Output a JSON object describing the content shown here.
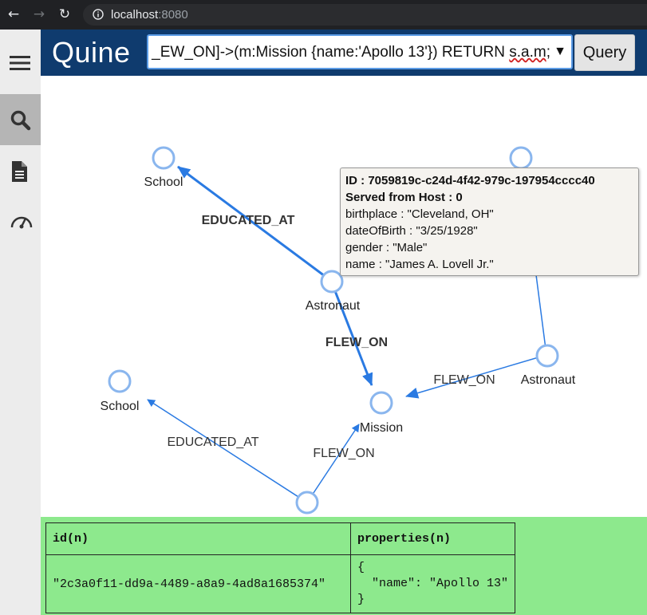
{
  "browser": {
    "url_host": "localhost",
    "url_port": ":8080"
  },
  "header": {
    "logo": "Quine",
    "query_prefix": "_EW_ON]->(m:Mission {name:'Apollo 13'}) RETURN ",
    "query_suffix": "s.a.m;",
    "query_button": "Query"
  },
  "graph": {
    "node_labels": {
      "school1": "School",
      "astronaut1": "Astronaut",
      "school2": "School",
      "mission": "Mission",
      "astronaut2": "Astronaut"
    },
    "edge_labels": {
      "educated_at_1": "EDUCATED_AT",
      "flew_on_1": "FLEW_ON",
      "flew_on_2": "FLEW_ON",
      "educated_at_2": "EDUCATED_AT",
      "flew_on_3": "FLEW_ON"
    },
    "node_color": "#8ab6ee",
    "edge_color": "#2a7ae2"
  },
  "tooltip": {
    "id_line": "ID : 7059819c-c24d-4f42-979c-197954cccc40",
    "host_line": "Served from Host : 0",
    "birthplace": "birthplace : \"Cleveland, OH\"",
    "dob": "dateOfBirth : \"3/25/1928\"",
    "gender": "gender : \"Male\"",
    "name": "name : \"James A. Lovell Jr.\""
  },
  "results": {
    "col1": "id(n)",
    "col2": "properties(n)",
    "row1_id": "\"2c3a0f11-dd9a-4489-a8a9-4ad8a1685374\"",
    "row1_props": "{\n  \"name\": \"Apollo 13\"\n}"
  }
}
